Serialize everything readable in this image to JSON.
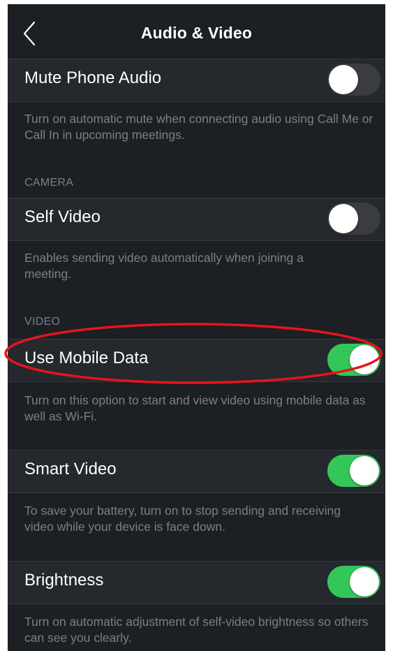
{
  "nav": {
    "title": "Audio & Video",
    "back_icon": "chevron-left-icon"
  },
  "settings": [
    {
      "label": "Mute Phone Audio",
      "enabled": false,
      "description": "Turn on automatic mute when connecting audio using Call Me or Call In in upcoming meetings."
    },
    {
      "section": "CAMERA",
      "label": "Self Video",
      "enabled": false,
      "description": "Enables sending video automatically when joining a meeting."
    },
    {
      "section": "VIDEO",
      "label": "Use Mobile Data",
      "enabled": true,
      "description": "Turn on this option to start and view video using mobile data as well as Wi-Fi."
    },
    {
      "label": "Smart Video",
      "enabled": true,
      "description": "To save your battery, turn on to stop sending and receiving video while your device is face down."
    },
    {
      "label": "Brightness",
      "enabled": true,
      "description": "Turn on automatic adjustment of self-video brightness so others can see you clearly."
    }
  ],
  "colors": {
    "background": "#1c1f24",
    "row": "#25282d",
    "toggle_on": "#33c75a",
    "toggle_off": "#3a3c40",
    "annotation": "#e8141b"
  }
}
